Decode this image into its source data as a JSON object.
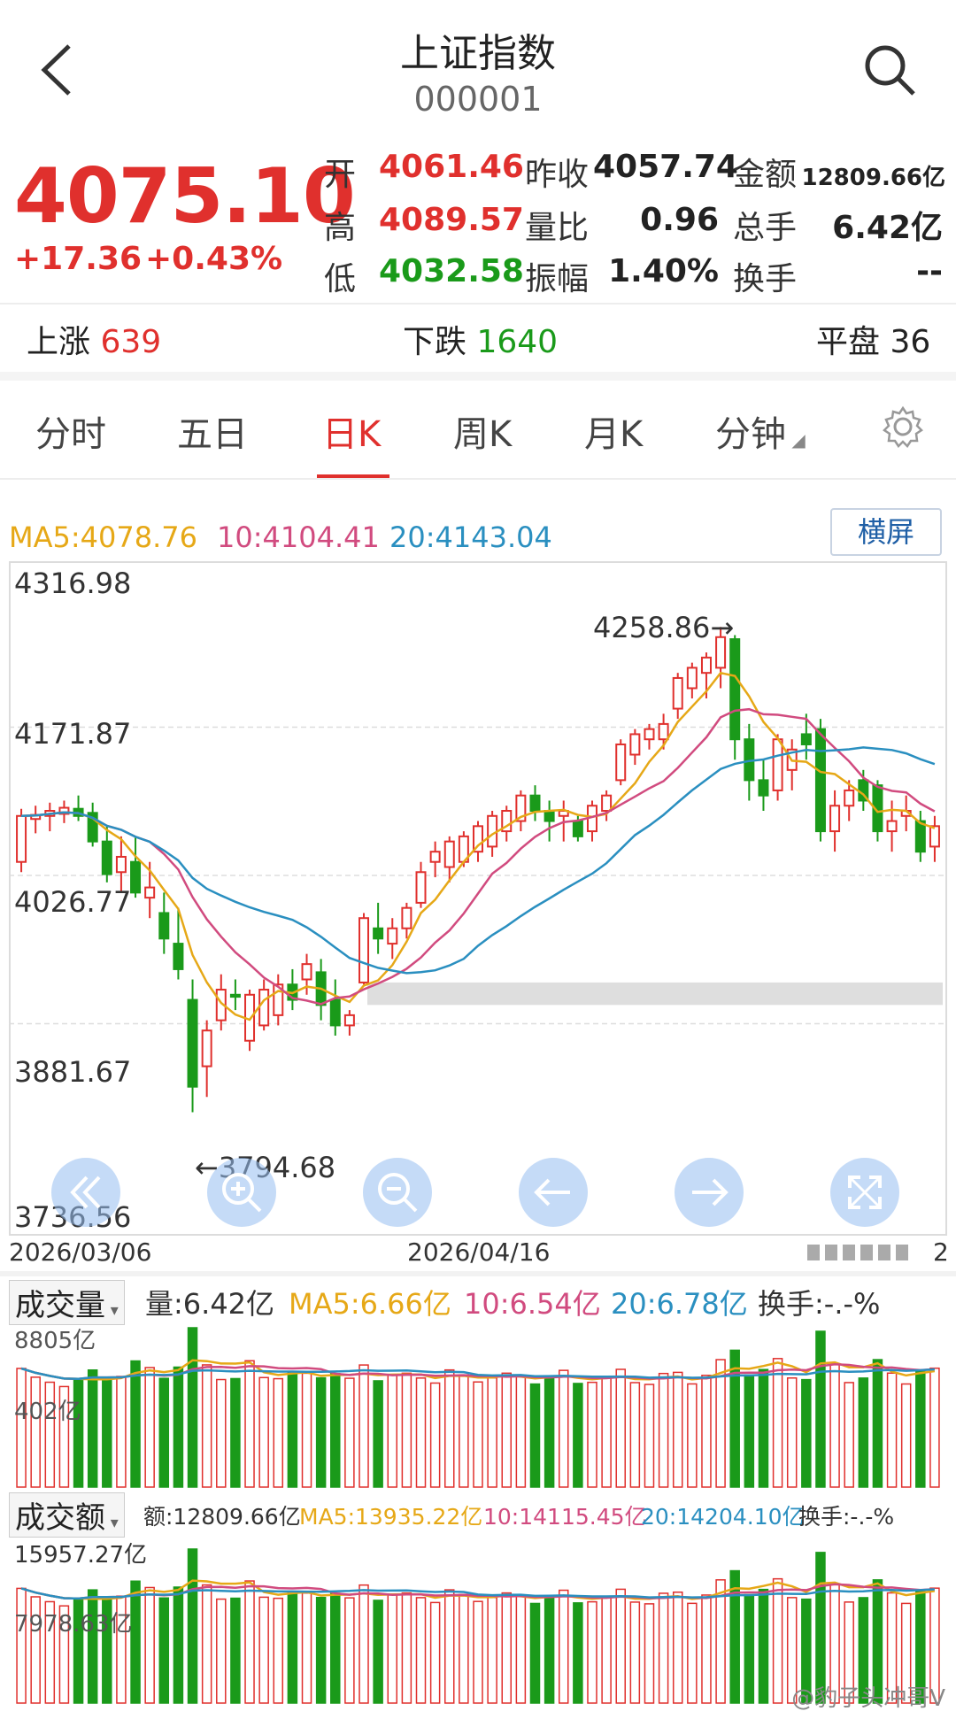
{
  "header": {
    "title": "上证指数",
    "code": "000001"
  },
  "quote": {
    "price": "4075.10",
    "change": "+17.36",
    "change_pct": "+0.43%",
    "open_label": "开",
    "open": "4061.46",
    "high_label": "高",
    "high": "4089.57",
    "low_label": "低",
    "low": "4032.58",
    "prev_close_label": "昨收",
    "prev_close": "4057.74",
    "vol_ratio_label": "量比",
    "vol_ratio": "0.96",
    "amplitude_label": "振幅",
    "amplitude": "1.40%",
    "amount_label": "金额",
    "amount": "12809.66亿",
    "total_hands_label": "总手",
    "total_hands": "6.42亿",
    "turnover_label": "换手",
    "turnover": "--"
  },
  "breadth": {
    "up_label": "上涨",
    "up": "639",
    "down_label": "下跌",
    "down": "1640",
    "flat_label": "平盘",
    "flat": "36"
  },
  "tabs": [
    "分时",
    "五日",
    "日K",
    "周K",
    "月K",
    "分钟"
  ],
  "active_tab": "日K",
  "ma_line": {
    "ma5": "MA5:4078.76",
    "ma10": "10:4104.41",
    "ma20": "20:4143.04"
  },
  "landscape_label": "横屏",
  "price_axis": [
    "4316.98",
    "4171.87",
    "4026.77",
    "3881.67",
    "3736.56"
  ],
  "annotations": {
    "high": "4258.86→",
    "low": "←3794.68"
  },
  "date_axis": {
    "start": "2026/03/06",
    "mid": "2026/04/16",
    "end": "2"
  },
  "volume_panel": {
    "selector": "成交量",
    "vol": "量:6.42亿",
    "ma5": "MA5:6.66亿",
    "ma10": "10:6.54亿",
    "ma20": "20:6.78亿",
    "turnover": "换手:-.-%",
    "axis_top": "8805亿",
    "axis_mid": "402亿"
  },
  "amount_panel": {
    "selector": "成交额",
    "amt": "额:12809.66亿",
    "ma5": "MA5:13935.22亿",
    "ma10": "10:14115.45亿",
    "ma20": "20:14204.10亿",
    "turnover": "换手:-.-%",
    "axis_top": "15957.27亿",
    "axis_mid": "7978.63亿"
  },
  "watermark": "@豹子头冲哥V",
  "colors": {
    "up": "#e0302d",
    "down": "#1a9a1a",
    "ma5": "#e6a817",
    "ma10": "#d14b7f",
    "ma20": "#2a8fc0"
  },
  "icons": [
    "back-arrow-icon",
    "search-icon",
    "settings-gear-icon",
    "rewind-icon",
    "zoom-in-icon",
    "zoom-out-icon",
    "left-arrow-icon",
    "right-arrow-icon",
    "fullscreen-icon"
  ],
  "chart_data": {
    "type": "candlestick",
    "ylim": [
      3736.56,
      4316.98
    ],
    "ohlc": [
      [
        4040,
        4092,
        4030,
        4085
      ],
      [
        4082,
        4095,
        4068,
        4086
      ],
      [
        4085,
        4098,
        4070,
        4090
      ],
      [
        4087,
        4100,
        4078,
        4093
      ],
      [
        4092,
        4105,
        4080,
        4085
      ],
      [
        4088,
        4098,
        4055,
        4060
      ],
      [
        4060,
        4075,
        4020,
        4028
      ],
      [
        4030,
        4065,
        4010,
        4045
      ],
      [
        4040,
        4065,
        4005,
        4010
      ],
      [
        4005,
        4040,
        3985,
        4015
      ],
      [
        3990,
        4010,
        3950,
        3965
      ],
      [
        3960,
        3995,
        3925,
        3935
      ],
      [
        3905,
        3925,
        3795,
        3820
      ],
      [
        3840,
        3885,
        3810,
        3875
      ],
      [
        3885,
        3930,
        3875,
        3915
      ],
      [
        3910,
        3925,
        3895,
        3908
      ],
      [
        3865,
        3915,
        3855,
        3910
      ],
      [
        3880,
        3925,
        3875,
        3915
      ],
      [
        3890,
        3930,
        3880,
        3920
      ],
      [
        3920,
        3935,
        3895,
        3905
      ],
      [
        3925,
        3950,
        3910,
        3940
      ],
      [
        3932,
        3945,
        3885,
        3900
      ],
      [
        3905,
        3925,
        3870,
        3880
      ],
      [
        3880,
        3895,
        3870,
        3890
      ],
      [
        3922,
        3990,
        3920,
        3985
      ],
      [
        3975,
        4000,
        3950,
        3965
      ],
      [
        3960,
        3985,
        3945,
        3975
      ],
      [
        3975,
        4000,
        3965,
        3995
      ],
      [
        4000,
        4040,
        3995,
        4030
      ],
      [
        4040,
        4060,
        4025,
        4050
      ],
      [
        4035,
        4065,
        4020,
        4060
      ],
      [
        4040,
        4070,
        4035,
        4065
      ],
      [
        4050,
        4080,
        4040,
        4075
      ],
      [
        4055,
        4090,
        4045,
        4085
      ],
      [
        4070,
        4095,
        4060,
        4090
      ],
      [
        4080,
        4110,
        4070,
        4105
      ],
      [
        4105,
        4115,
        4080,
        4090
      ],
      [
        4090,
        4100,
        4060,
        4080
      ],
      [
        4085,
        4100,
        4060,
        4090
      ],
      [
        4080,
        4085,
        4060,
        4065
      ],
      [
        4070,
        4100,
        4060,
        4095
      ],
      [
        4090,
        4110,
        4080,
        4105
      ],
      [
        4120,
        4160,
        4115,
        4155
      ],
      [
        4145,
        4170,
        4135,
        4165
      ],
      [
        4160,
        4175,
        4150,
        4170
      ],
      [
        4160,
        4185,
        4150,
        4175
      ],
      [
        4190,
        4225,
        4180,
        4220
      ],
      [
        4210,
        4235,
        4200,
        4230
      ],
      [
        4225,
        4245,
        4200,
        4240
      ],
      [
        4230,
        4270,
        4210,
        4260
      ],
      [
        4258,
        4262,
        4140,
        4160
      ],
      [
        4160,
        4175,
        4100,
        4120
      ],
      [
        4120,
        4140,
        4090,
        4105
      ],
      [
        4110,
        4165,
        4100,
        4160
      ],
      [
        4130,
        4160,
        4110,
        4150
      ],
      [
        4165,
        4185,
        4140,
        4155
      ],
      [
        4170,
        4180,
        4060,
        4070
      ],
      [
        4070,
        4110,
        4050,
        4095
      ],
      [
        4095,
        4120,
        4080,
        4110
      ],
      [
        4120,
        4130,
        4090,
        4100
      ],
      [
        4115,
        4120,
        4060,
        4070
      ],
      [
        4070,
        4100,
        4050,
        4080
      ],
      [
        4085,
        4105,
        4070,
        4090
      ],
      [
        4080,
        4090,
        4040,
        4050
      ],
      [
        4055,
        4085,
        4040,
        4075
      ]
    ]
  }
}
